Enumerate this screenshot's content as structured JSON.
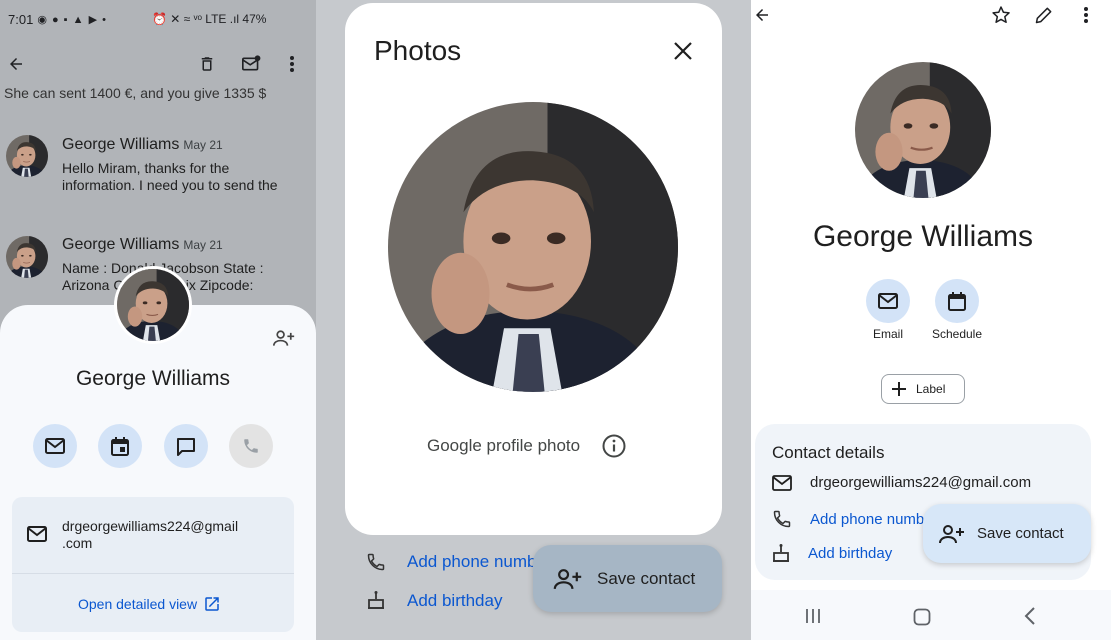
{
  "panel1": {
    "status_time": "7:01",
    "status_left_icons": "◉ ● ▪ ▲ ▶ •",
    "status_right": "⏰ ✕ ≈ ᵛᵒ LTE .ıl 47%",
    "partial_text": "She can sent 1400 €, and you give 1335 $",
    "emails": [
      {
        "name": "George Williams",
        "date": "May 21",
        "snippet": "Hello Miram, thanks for the information. I need you to send the"
      },
      {
        "name": "George Williams",
        "date": "May 21",
        "snippet": "Name : Donald Jacobson State : Arizona City: Phoenix Zipcode:"
      }
    ],
    "sheet": {
      "name": "George Williams",
      "email": "drgeorgewilliams224@gmail.com",
      "email_line1": "drgeorgewilliams224@gmail",
      "email_line2": ".com",
      "open_detailed": "Open detailed view"
    }
  },
  "panel2": {
    "dialog_title": "Photos",
    "caption": "Google profile photo",
    "under_phone": "Add phone numb",
    "under_birthday": "Add birthday",
    "save_contact": "Save contact"
  },
  "panel3": {
    "name": "George Williams",
    "email_action": "Email",
    "schedule_action": "Schedule",
    "label_chip": "Label",
    "details_head": "Contact details",
    "email": "drgeorgewilliams224@gmail.com",
    "add_phone": "Add phone numb",
    "add_birthday": "Add birthday",
    "save_contact": "Save contact"
  },
  "colors": {
    "accent_blue": "#0b57d0",
    "action_button_bg": "#d3e3f7",
    "fab_bg": "#d7e7f8"
  }
}
